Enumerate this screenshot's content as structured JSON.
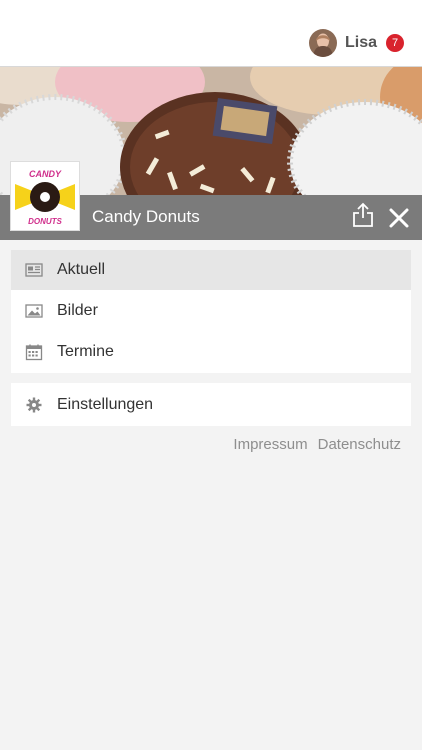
{
  "header": {
    "user_name": "Lisa",
    "notification_count": "7"
  },
  "business": {
    "name": "Candy Donuts",
    "logo_text_top": "CANDY",
    "logo_text_bottom": "DONUTS"
  },
  "menu": {
    "primary": [
      {
        "label": "Aktuell",
        "icon": "newspaper-icon",
        "active": true
      },
      {
        "label": "Bilder",
        "icon": "image-icon",
        "active": false
      },
      {
        "label": "Termine",
        "icon": "calendar-icon",
        "active": false
      }
    ],
    "secondary": [
      {
        "label": "Einstellungen",
        "icon": "gear-icon"
      }
    ]
  },
  "footer": {
    "impressum": "Impressum",
    "datenschutz": "Datenschutz"
  },
  "colors": {
    "badge": "#d9232d",
    "title_bar": "#7b7b7b",
    "active_item": "#e6e6e6"
  }
}
